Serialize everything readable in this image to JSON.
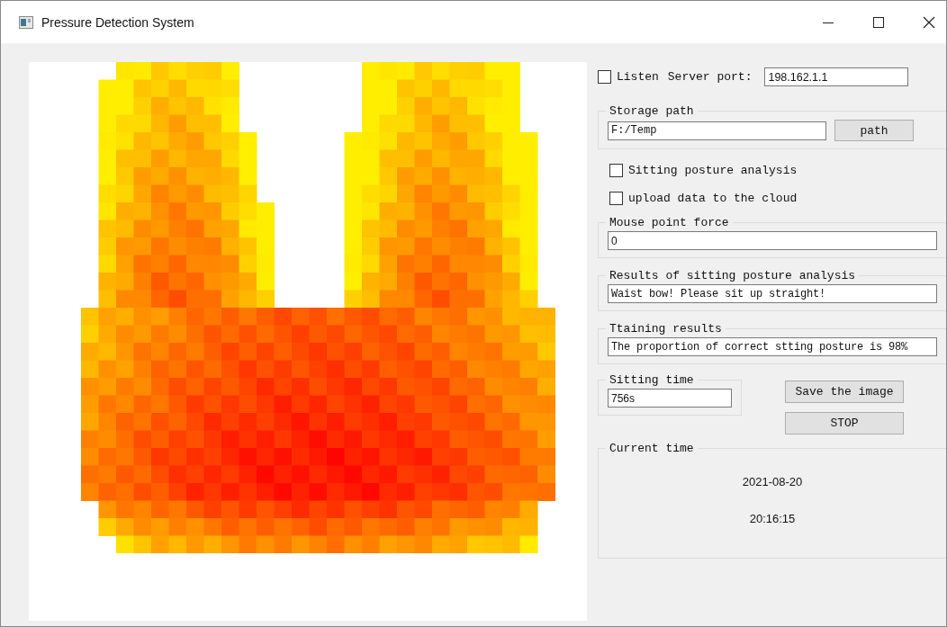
{
  "window": {
    "title": "Pressure Detection System"
  },
  "listen": {
    "label": "Listen",
    "checked": false
  },
  "server_port": {
    "label": "Server port:",
    "value": "198.162.1.1"
  },
  "storage_path": {
    "title": "Storage path",
    "value": "F:/Temp",
    "button": "path"
  },
  "options": [
    {
      "label": "Sitting posture analysis",
      "checked": false
    },
    {
      "label": "upload data to the cloud",
      "checked": false
    }
  ],
  "mouse_point_force": {
    "title": "Mouse point force",
    "value": "0"
  },
  "posture_results": {
    "title": "Results of sitting posture analysis",
    "value": "Waist bow! Please sit up straight!"
  },
  "training_results": {
    "title": "Ttaining results",
    "value": "The proportion of correct stting posture is 98%"
  },
  "sitting_time": {
    "title": "Sitting time",
    "value": "756s"
  },
  "buttons": [
    "Save the image",
    "STOP"
  ],
  "current_time": {
    "title": "Current time",
    "date": "2021-08-20",
    "time": "20:16:15"
  }
}
